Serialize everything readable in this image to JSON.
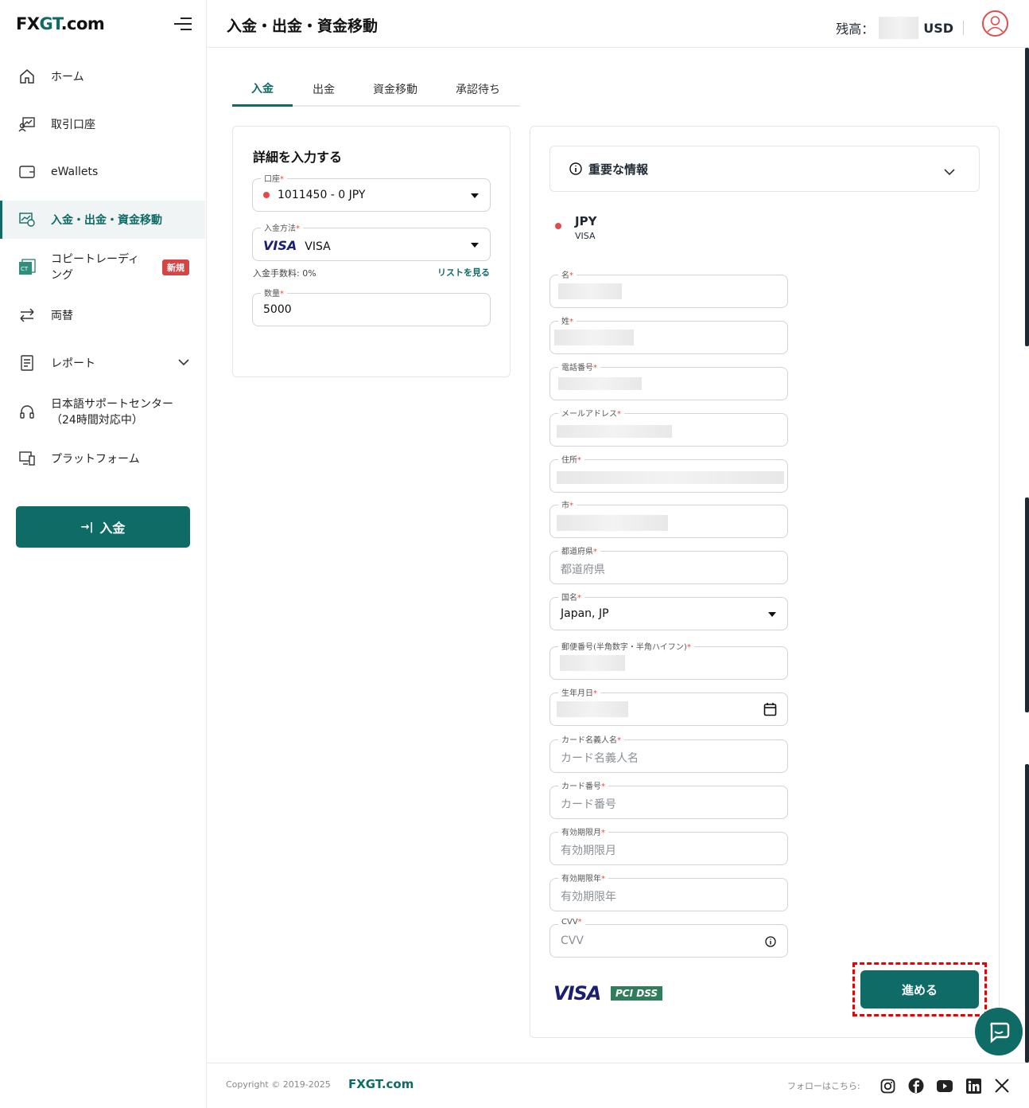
{
  "app": {
    "logo_fx": "FX",
    "logo_gt": "GT",
    "logo_com": ".com"
  },
  "sidebar": {
    "items": [
      {
        "label": "ホーム"
      },
      {
        "label": "取引口座"
      },
      {
        "label": "eWallets"
      },
      {
        "label": "入金・出金・資金移動"
      },
      {
        "label": "コピートレーディング"
      },
      {
        "label": "両替"
      },
      {
        "label": "レポート"
      },
      {
        "label": "日本語サポートセンター（24時間対応中）"
      },
      {
        "label": "プラットフォーム"
      }
    ],
    "copy_line1": "コピートレーディ",
    "copy_line2": "ング",
    "support_line1": "日本語サポートセンター",
    "support_line2": "（24時間対応中）",
    "new_badge": "新規",
    "deposit_button": "入金",
    "deposit_icon": "→|"
  },
  "header": {
    "title": "入金・出金・資金移動",
    "balance_label": "残高：",
    "balance_currency": "USD"
  },
  "tabs": [
    {
      "label": "入金",
      "active": true
    },
    {
      "label": "出金"
    },
    {
      "label": "資金移動"
    },
    {
      "label": "承認待ち"
    }
  ],
  "details": {
    "title": "詳細を入力する",
    "account_label": "口座",
    "account_value": "1011450 - 0 JPY",
    "method_label": "入金方法",
    "method_logo": "VISA",
    "method_value": "VISA",
    "fee_text": "入金手数料: 0%",
    "list_link": "リストを見る",
    "amount_label": "数量",
    "amount_value": "5000",
    "required_mark": "*"
  },
  "info": {
    "important_label": "重要な情報",
    "currency": "JPY",
    "method": "VISA"
  },
  "form": {
    "first_name_label": "名",
    "last_name_label": "姓",
    "phone_label": "電話番号",
    "email_label": "メールアドレス",
    "address_label": "住所",
    "city_label": "市",
    "prefecture_label": "都道府県",
    "prefecture_placeholder": "都道府県",
    "country_label": "国名",
    "country_value": "Japan, JP",
    "postal_label": "郵便番号(半角数字・半角ハイフン)",
    "dob_label": "生年月日",
    "card_holder_label": "カード名義人名",
    "card_holder_placeholder": "カード名義人名",
    "card_number_label": "カード番号",
    "card_number_placeholder": "カード番号",
    "exp_month_label": "有効期限月",
    "exp_month_placeholder": "有効期限月",
    "exp_year_label": "有効期限年",
    "exp_year_placeholder": "有効期限年",
    "cvv_label": "CVV",
    "cvv_placeholder": "CVV",
    "visa_logo": "VISA",
    "pci_logo": "PCI DSS",
    "submit": "進める"
  },
  "footer": {
    "copyright": "Copyright © 2019-2025",
    "brand": "FXGT.com",
    "follow": "フォローはこちら:"
  },
  "colors": {
    "accent": "#0f6b66",
    "danger": "#e34b4b"
  }
}
